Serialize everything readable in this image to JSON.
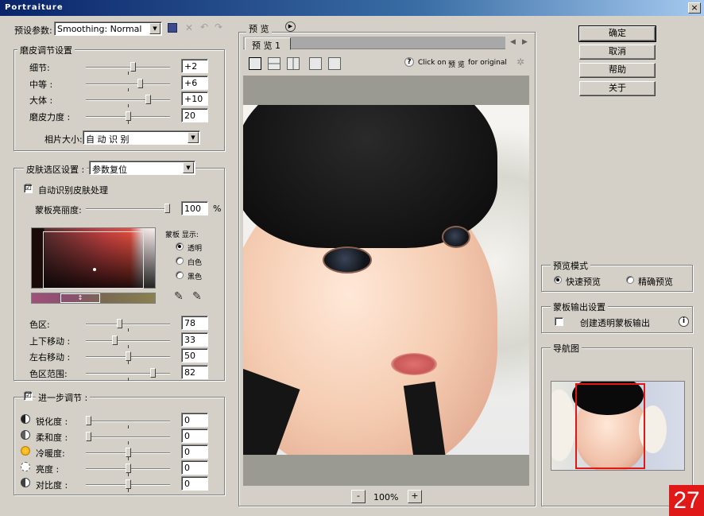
{
  "window": {
    "title": "Portraiture",
    "close": "×"
  },
  "presets": {
    "label": "预设参数:",
    "value": "Smoothing: Normal"
  },
  "detail_smoothing": {
    "title": "磨皮调节设置",
    "rows": [
      {
        "label": "细节:",
        "value": "+2",
        "pos": 0.57
      },
      {
        "label": "中等 :",
        "value": "+6",
        "pos": 0.66
      },
      {
        "label": "大体 :",
        "value": "+10",
        "pos": 0.76
      },
      {
        "label": "磨皮力度 :",
        "value": "20",
        "pos": 0.5
      }
    ],
    "portrait_size_label": "相片大小:",
    "portrait_size_value": "自 动 识 别"
  },
  "skin_mask": {
    "title": "皮肤选区设置 :",
    "dropdown": "参数复位",
    "auto_label": "自动识别皮肤处理",
    "auto_checked": "☑",
    "opacity_label": "蒙板亮丽度:",
    "opacity_value": "100",
    "opacity_unit": "%",
    "opacity_pos": 1.0,
    "mask_preview_title": "蒙板 显示:",
    "mask_options": [
      "透明",
      "白色",
      "黑色"
    ],
    "sliders": [
      {
        "label": "色区:",
        "value": "78",
        "pos": 0.39
      },
      {
        "label": "上下移动 :",
        "value": "33",
        "pos": 0.33
      },
      {
        "label": "左右移动 :",
        "value": "50",
        "pos": 0.5
      },
      {
        "label": "色区范围:",
        "value": "82",
        "pos": 0.82
      }
    ]
  },
  "enhancements": {
    "title": "进一步调节 :",
    "checked": "☑",
    "rows": [
      {
        "label": "锐化度 :",
        "value": "0",
        "icon": "sharpness-icon",
        "pos": 0.0
      },
      {
        "label": "柔和度 :",
        "value": "0",
        "icon": "softness-icon",
        "pos": 0.0
      },
      {
        "label": "冷暖度:",
        "value": "0",
        "icon": "warmth-icon",
        "pos": 0.5
      },
      {
        "label": "亮度 :",
        "value": "0",
        "icon": "brightness-icon",
        "pos": 0.5
      },
      {
        "label": "对比度 :",
        "value": "0",
        "icon": "contrast-icon",
        "pos": 0.5
      }
    ]
  },
  "preview": {
    "title": "预 览",
    "tab": "预 览  1",
    "hint_q": "?",
    "hint_a": "Click on",
    "hint_b": "预 览",
    "hint_c": "for original",
    "zoom": "100%",
    "zoom_minus": "-",
    "zoom_plus": "+"
  },
  "buttons": {
    "ok": "确定",
    "cancel": "取消",
    "help": "帮助",
    "about": "关于"
  },
  "preview_mode": {
    "title": "预览模式",
    "options": [
      "快速预览",
      "精确预览"
    ]
  },
  "mask_output": {
    "title": "蒙板输出设置",
    "option": "创建透明蒙板输出",
    "info": "i"
  },
  "navigator": {
    "title": "导航图"
  },
  "badge": "27"
}
